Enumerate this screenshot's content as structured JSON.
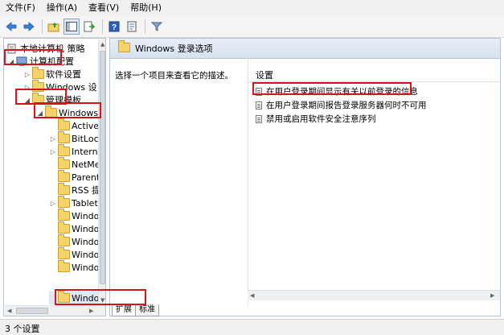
{
  "menubar": {
    "items": [
      "文件(F)",
      "操作(A)",
      "查看(V)",
      "帮助(H)"
    ]
  },
  "toolbar": {
    "icons": [
      "back-arrow-icon",
      "forward-arrow-icon",
      "up-folder-icon",
      "show-hide-tree-icon",
      "export-list-icon",
      "help-icon",
      "properties-icon",
      "filter-icon"
    ]
  },
  "tree": {
    "items": [
      {
        "label": "本地计算机 策略",
        "icon": "policy-icon"
      },
      {
        "label": "计算机配置",
        "icon": "computer-icon"
      },
      {
        "label": "软件设置",
        "icon": "folder-icon"
      },
      {
        "label": "Windows 设",
        "icon": "folder-icon"
      },
      {
        "label": "管理模板",
        "icon": "folder-icon"
      },
      {
        "label": "Windows",
        "icon": "folder-icon"
      },
      {
        "label": "Active",
        "icon": "folder-icon"
      },
      {
        "label": "BitLoc",
        "icon": "folder-icon"
      },
      {
        "label": "Intern",
        "icon": "folder-icon"
      },
      {
        "label": "NetMe",
        "icon": "folder-icon"
      },
      {
        "label": "Parent",
        "icon": "folder-icon"
      },
      {
        "label": "RSS 提",
        "icon": "folder-icon"
      },
      {
        "label": "Tablet",
        "icon": "folder-icon"
      },
      {
        "label": "Windo",
        "icon": "folder-icon"
      },
      {
        "label": "Windo",
        "icon": "folder-icon"
      },
      {
        "label": "Windo",
        "icon": "folder-icon"
      },
      {
        "label": "Windo",
        "icon": "folder-icon"
      },
      {
        "label": "Windo",
        "icon": "folder-icon"
      },
      {
        "label": "Windows 登录选项",
        "icon": "folder-icon"
      }
    ]
  },
  "right_pane": {
    "title": "Windows 登录选项",
    "description": "选择一个项目来查看它的描述。",
    "column_header": "设置",
    "settings": [
      "在用户登录期间显示有关以前登录的信息",
      "在用户登录期间报告登录服务器何时不可用",
      "禁用或启用软件安全注意序列"
    ]
  },
  "tabs": [
    "扩展",
    "标准"
  ],
  "status": "3 个设置",
  "colors": {
    "highlight_box": "#d8141b",
    "folder": "#f4d36b",
    "header_gradient": "#d6e1ef"
  }
}
